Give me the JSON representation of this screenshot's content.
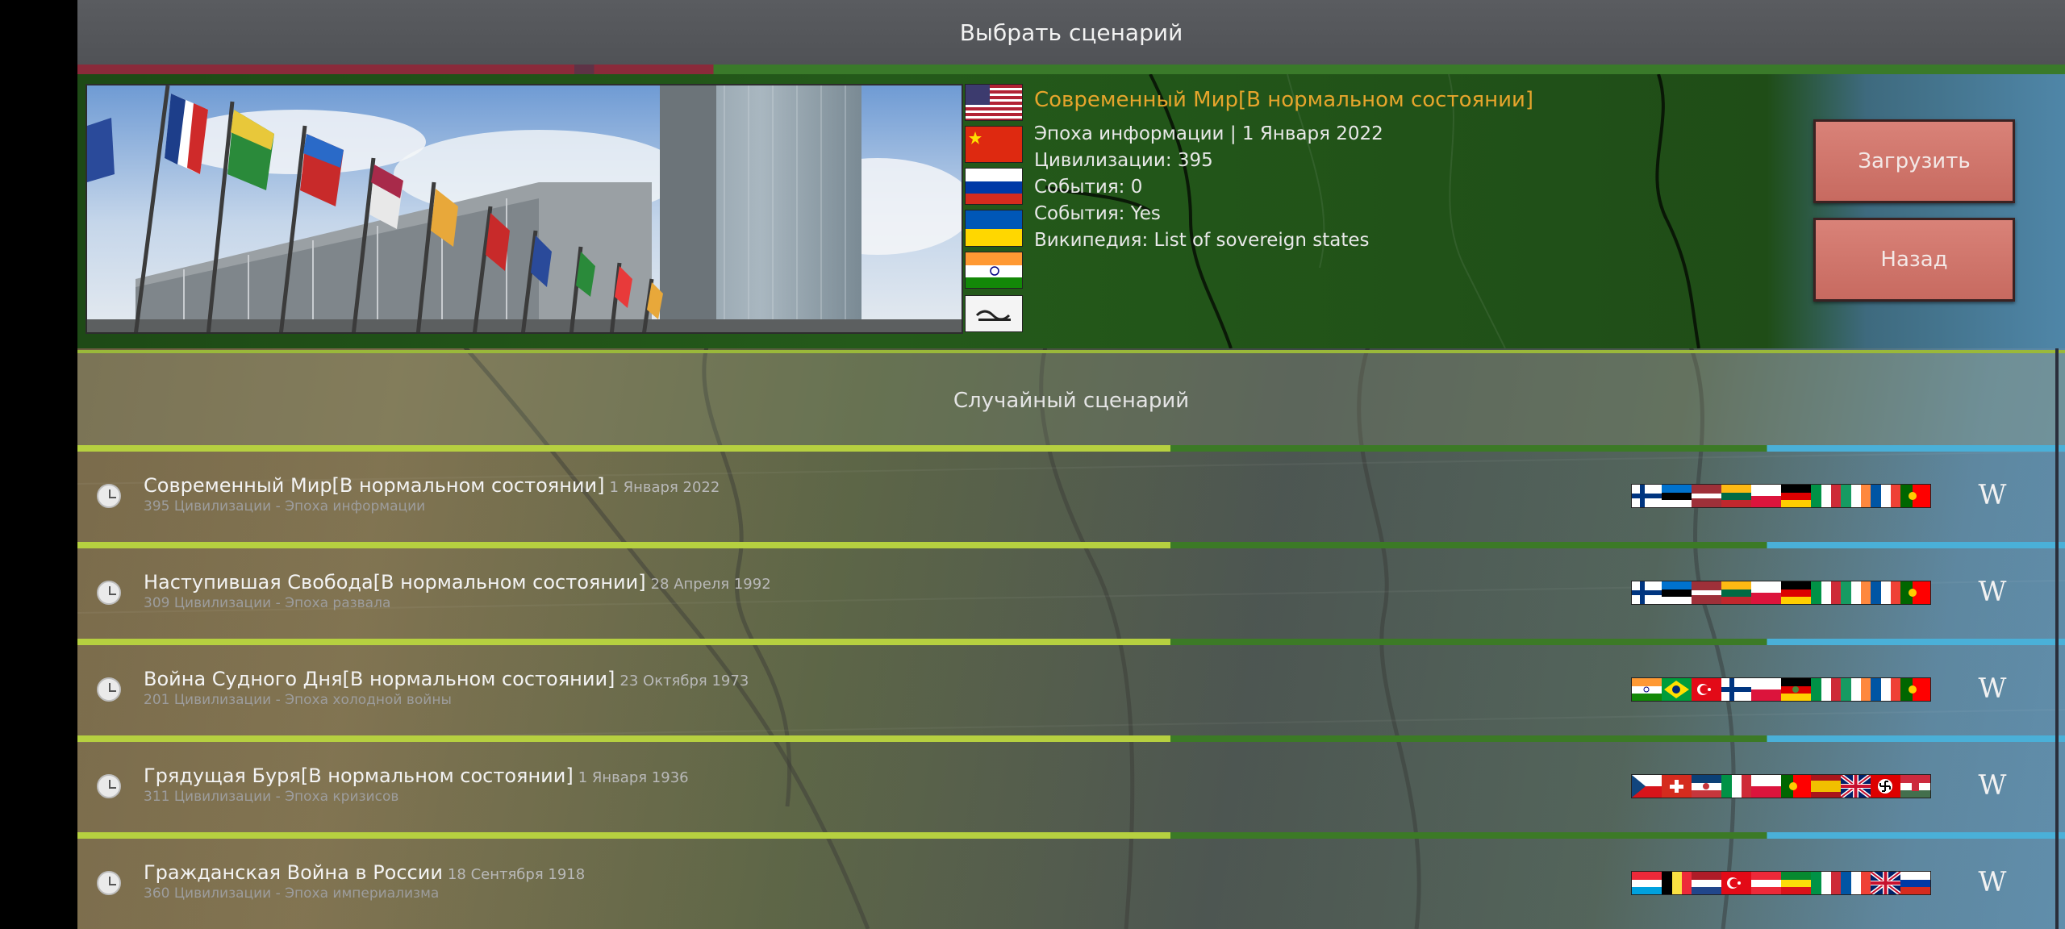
{
  "header": {
    "title": "Выбрать сценарий"
  },
  "featured": {
    "title": "Современный Мир[В нормальном состоянии]",
    "era_line": "Эпоха информации | 1 Января 2022",
    "civs_line": "Цивилизации: 395",
    "events_line": "События: 0",
    "events2_line": "События: Yes",
    "wiki_line": "Википедия: List of sovereign states",
    "flags": [
      "usa",
      "china",
      "russia",
      "ukraine",
      "india",
      "afghanistan"
    ]
  },
  "buttons": {
    "load": "Загрузить",
    "back": "Назад"
  },
  "random": {
    "label": "Случайный сценарий"
  },
  "scenarios": [
    {
      "name": "Современный Мир[В нормальном состоянии]",
      "date": "1 Января 2022",
      "sub": "395 Цивилизации - Эпоха информации",
      "flags": [
        "finland",
        "estonia",
        "latvia",
        "lithuania",
        "poland",
        "germany",
        "italy",
        "ireland",
        "france",
        "portugal"
      ]
    },
    {
      "name": "Наступившая Свобода[В нормальном состоянии]",
      "date": "28 Апреля 1992",
      "sub": "309 Цивилизации - Эпоха развала",
      "flags": [
        "finland",
        "estonia",
        "latvia",
        "lithuania",
        "poland",
        "germany",
        "italy",
        "ireland",
        "france",
        "portugal"
      ]
    },
    {
      "name": "Война Судного Дня[В нормальном состоянии]",
      "date": "23 Октября 1973",
      "sub": "201 Цивилизации - Эпоха холодной войны",
      "flags": [
        "india",
        "brazil",
        "turkey",
        "finland",
        "poland",
        "east-germany",
        "italy",
        "ireland",
        "france",
        "portugal"
      ]
    },
    {
      "name": "Грядущая Буря[В нормальном состоянии]",
      "date": "1 Января 1936",
      "sub": "311 Цивилизации - Эпоха кризисов",
      "flags": [
        "czech",
        "switzerland",
        "yugoslavia",
        "italy",
        "poland",
        "portugal",
        "spain",
        "uk",
        "nazi-germany",
        "hungary"
      ]
    },
    {
      "name": "Гражданская Война в России",
      "date": "18 Сентября 1918",
      "sub": "360 Цивилизации - Эпоха империализма",
      "flags": [
        "luxembourg",
        "belgium",
        "netherlands",
        "turkey",
        "austria",
        "ethiopia",
        "italy",
        "france",
        "uk",
        "russia"
      ]
    }
  ],
  "wiki_icon_label": "W",
  "colors": {
    "accent_title": "#e6a52c",
    "button": "#d98278",
    "separator_green": "#b6d040"
  }
}
